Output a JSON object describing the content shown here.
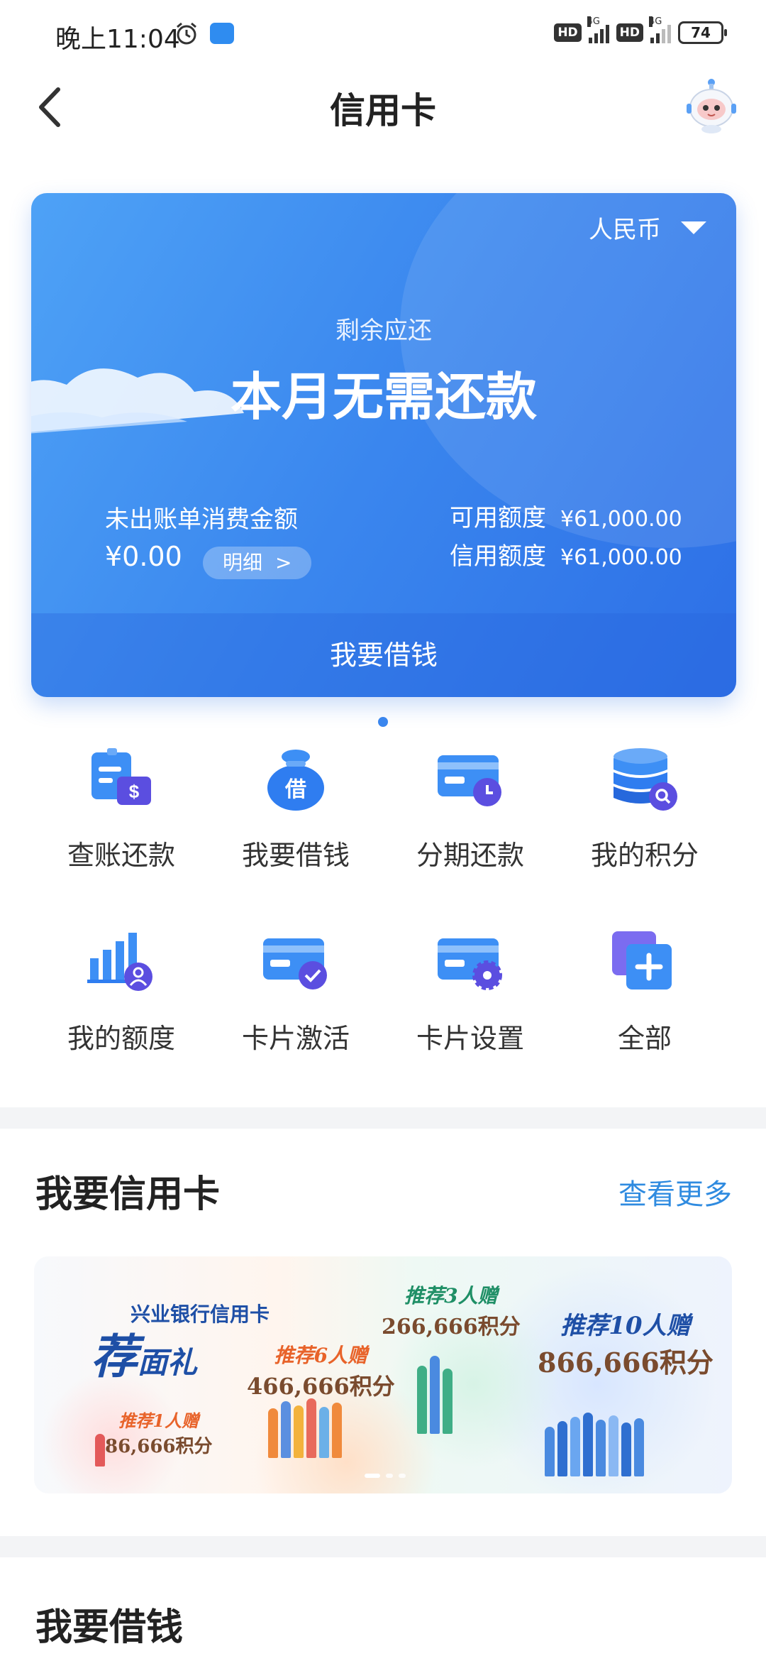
{
  "status_bar": {
    "time": "晚上11:04",
    "hd1": "HD",
    "hd2": "HD",
    "net1": "4G",
    "net2": "4G",
    "battery": "74"
  },
  "nav": {
    "title": "信用卡"
  },
  "card": {
    "currency": "人民币",
    "remaining_label": "剩余应还",
    "remaining_value": "本月无需还款",
    "unbilled_label": "未出账单消费金额",
    "unbilled_value": "¥0.00",
    "detail_label": "明细",
    "detail_arrow": ">",
    "available_label": "可用额度",
    "available_value": "¥61,000.00",
    "credit_label": "信用额度",
    "credit_value": "¥61,000.00",
    "borrow_label": "我要借钱",
    "accent": "#3a86ee"
  },
  "grid": [
    {
      "label": "查账还款",
      "icon": "bill-repay-icon"
    },
    {
      "label": "我要借钱",
      "icon": "money-bag-icon"
    },
    {
      "label": "分期还款",
      "icon": "installment-card-icon"
    },
    {
      "label": "我的积分",
      "icon": "points-database-icon"
    },
    {
      "label": "我的额度",
      "icon": "limit-chart-icon"
    },
    {
      "label": "卡片激活",
      "icon": "card-activate-icon"
    },
    {
      "label": "卡片设置",
      "icon": "card-settings-icon"
    },
    {
      "label": "全部",
      "icon": "all-plus-icon"
    }
  ],
  "section_card": {
    "title": "我要信用卡",
    "more": "查看更多"
  },
  "banner": {
    "brand": "兴业银行信用卡",
    "gift_big": "荐",
    "gift_small": "面礼",
    "tiers": [
      {
        "title": "推荐1人赠",
        "points": "86,666积分"
      },
      {
        "title": "推荐6人赠",
        "points": "466,666积分"
      },
      {
        "title": "推荐3人赠",
        "points": "266,666积分"
      },
      {
        "title": "推荐10人赠",
        "points": "866,666积分"
      }
    ]
  },
  "section_borrow": {
    "title": "我要借钱"
  }
}
